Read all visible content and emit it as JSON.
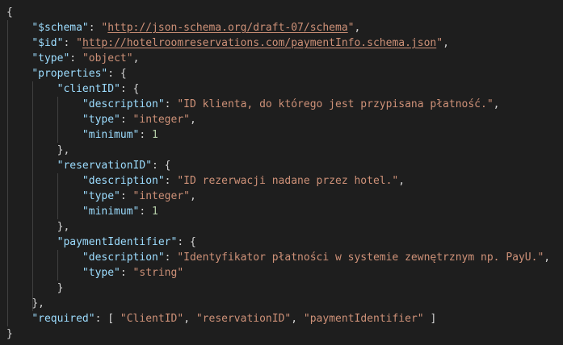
{
  "editor": {
    "colors": {
      "background": "#1e1e1e",
      "key": "#9cdcfe",
      "string": "#ce9178",
      "number": "#b5cea8",
      "punctuation": "#d4d4d4"
    },
    "lines": [
      [
        {
          "t": "p",
          "v": "{"
        }
      ],
      [
        {
          "t": "ws",
          "v": "    "
        },
        {
          "t": "k",
          "v": "\"$schema\""
        },
        {
          "t": "p",
          "v": ": "
        },
        {
          "t": "s",
          "v": "\""
        },
        {
          "t": "u",
          "v": "http://json-schema.org/draft-07/schema"
        },
        {
          "t": "s",
          "v": "\""
        },
        {
          "t": "p",
          "v": ","
        }
      ],
      [
        {
          "t": "ws",
          "v": "    "
        },
        {
          "t": "k",
          "v": "\"$id\""
        },
        {
          "t": "p",
          "v": ": "
        },
        {
          "t": "s",
          "v": "\""
        },
        {
          "t": "u",
          "v": "http://hotelroomreservations.com/paymentInfo.schema.json"
        },
        {
          "t": "s",
          "v": "\""
        },
        {
          "t": "p",
          "v": ","
        }
      ],
      [
        {
          "t": "ws",
          "v": "    "
        },
        {
          "t": "k",
          "v": "\"type\""
        },
        {
          "t": "p",
          "v": ": "
        },
        {
          "t": "s",
          "v": "\"object\""
        },
        {
          "t": "p",
          "v": ","
        }
      ],
      [
        {
          "t": "ws",
          "v": "    "
        },
        {
          "t": "k",
          "v": "\"properties\""
        },
        {
          "t": "p",
          "v": ": {"
        }
      ],
      [
        {
          "t": "ws",
          "v": "        "
        },
        {
          "t": "k",
          "v": "\"clientID\""
        },
        {
          "t": "p",
          "v": ": {"
        }
      ],
      [
        {
          "t": "ws",
          "v": "            "
        },
        {
          "t": "k",
          "v": "\"description\""
        },
        {
          "t": "p",
          "v": ": "
        },
        {
          "t": "s",
          "v": "\"ID klienta, do którego jest przypisana płatność.\""
        },
        {
          "t": "p",
          "v": ","
        }
      ],
      [
        {
          "t": "ws",
          "v": "            "
        },
        {
          "t": "k",
          "v": "\"type\""
        },
        {
          "t": "p",
          "v": ": "
        },
        {
          "t": "s",
          "v": "\"integer\""
        },
        {
          "t": "p",
          "v": ","
        }
      ],
      [
        {
          "t": "ws",
          "v": "            "
        },
        {
          "t": "k",
          "v": "\"minimum\""
        },
        {
          "t": "p",
          "v": ": "
        },
        {
          "t": "n",
          "v": "1"
        }
      ],
      [
        {
          "t": "ws",
          "v": "        "
        },
        {
          "t": "p",
          "v": "},"
        }
      ],
      [
        {
          "t": "ws",
          "v": "        "
        },
        {
          "t": "k",
          "v": "\"reservationID\""
        },
        {
          "t": "p",
          "v": ": {"
        }
      ],
      [
        {
          "t": "ws",
          "v": "            "
        },
        {
          "t": "k",
          "v": "\"description\""
        },
        {
          "t": "p",
          "v": ": "
        },
        {
          "t": "s",
          "v": "\"ID rezerwacji nadane przez hotel.\""
        },
        {
          "t": "p",
          "v": ","
        }
      ],
      [
        {
          "t": "ws",
          "v": "            "
        },
        {
          "t": "k",
          "v": "\"type\""
        },
        {
          "t": "p",
          "v": ": "
        },
        {
          "t": "s",
          "v": "\"integer\""
        },
        {
          "t": "p",
          "v": ","
        }
      ],
      [
        {
          "t": "ws",
          "v": "            "
        },
        {
          "t": "k",
          "v": "\"minimum\""
        },
        {
          "t": "p",
          "v": ": "
        },
        {
          "t": "n",
          "v": "1"
        }
      ],
      [
        {
          "t": "ws",
          "v": "        "
        },
        {
          "t": "p",
          "v": "},"
        }
      ],
      [
        {
          "t": "ws",
          "v": "        "
        },
        {
          "t": "k",
          "v": "\"paymentIdentifier\""
        },
        {
          "t": "p",
          "v": ": {"
        }
      ],
      [
        {
          "t": "ws",
          "v": "            "
        },
        {
          "t": "k",
          "v": "\"description\""
        },
        {
          "t": "p",
          "v": ": "
        },
        {
          "t": "s",
          "v": "\"Identyfikator płatności w systemie zewnętrznym np. PayU.\""
        },
        {
          "t": "p",
          "v": ","
        }
      ],
      [
        {
          "t": "ws",
          "v": "            "
        },
        {
          "t": "k",
          "v": "\"type\""
        },
        {
          "t": "p",
          "v": ": "
        },
        {
          "t": "s",
          "v": "\"string\""
        }
      ],
      [
        {
          "t": "ws",
          "v": "        "
        },
        {
          "t": "p",
          "v": "}"
        }
      ],
      [
        {
          "t": "ws",
          "v": "    "
        },
        {
          "t": "p",
          "v": "},"
        }
      ],
      [
        {
          "t": "ws",
          "v": "    "
        },
        {
          "t": "k",
          "v": "\"required\""
        },
        {
          "t": "p",
          "v": ": [ "
        },
        {
          "t": "s",
          "v": "\"ClientID\""
        },
        {
          "t": "p",
          "v": ", "
        },
        {
          "t": "s",
          "v": "\"reservationID\""
        },
        {
          "t": "p",
          "v": ", "
        },
        {
          "t": "s",
          "v": "\"paymentIdentifier\""
        },
        {
          "t": "p",
          "v": " ]"
        }
      ],
      [
        {
          "t": "p",
          "v": "}"
        }
      ]
    ]
  }
}
